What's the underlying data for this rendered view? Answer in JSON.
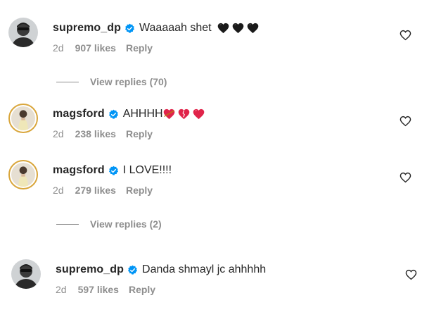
{
  "comments": [
    {
      "username": "supremo_dp",
      "text": "Waaaaah shet",
      "emojis": [
        "black-heart-icon",
        "black-heart-icon",
        "black-heart-icon"
      ],
      "age": "2d",
      "likes": "907 likes",
      "reply": "Reply",
      "view_replies": "View replies (70)"
    },
    {
      "username": "magsford",
      "text": "AHHHH",
      "emojis": [
        "heart-with-arrow-icon",
        "broken-heart-icon",
        "red-heart-icon"
      ],
      "age": "2d",
      "likes": "238 likes",
      "reply": "Reply"
    },
    {
      "username": "magsford",
      "text": "I LOVE!!!!",
      "age": "2d",
      "likes": "279 likes",
      "reply": "Reply",
      "view_replies": "View replies (2)"
    },
    {
      "username": "supremo_dp",
      "text": "Danda shmayl jc ahhhhh",
      "age": "2d",
      "likes": "597 likes",
      "reply": "Reply"
    }
  ],
  "colors": {
    "text": "#262626",
    "secondary": "#8e8e8e",
    "verified": "#0095f6",
    "heart_red": "#e0244a",
    "avatar_ring": "#d9a63c"
  }
}
